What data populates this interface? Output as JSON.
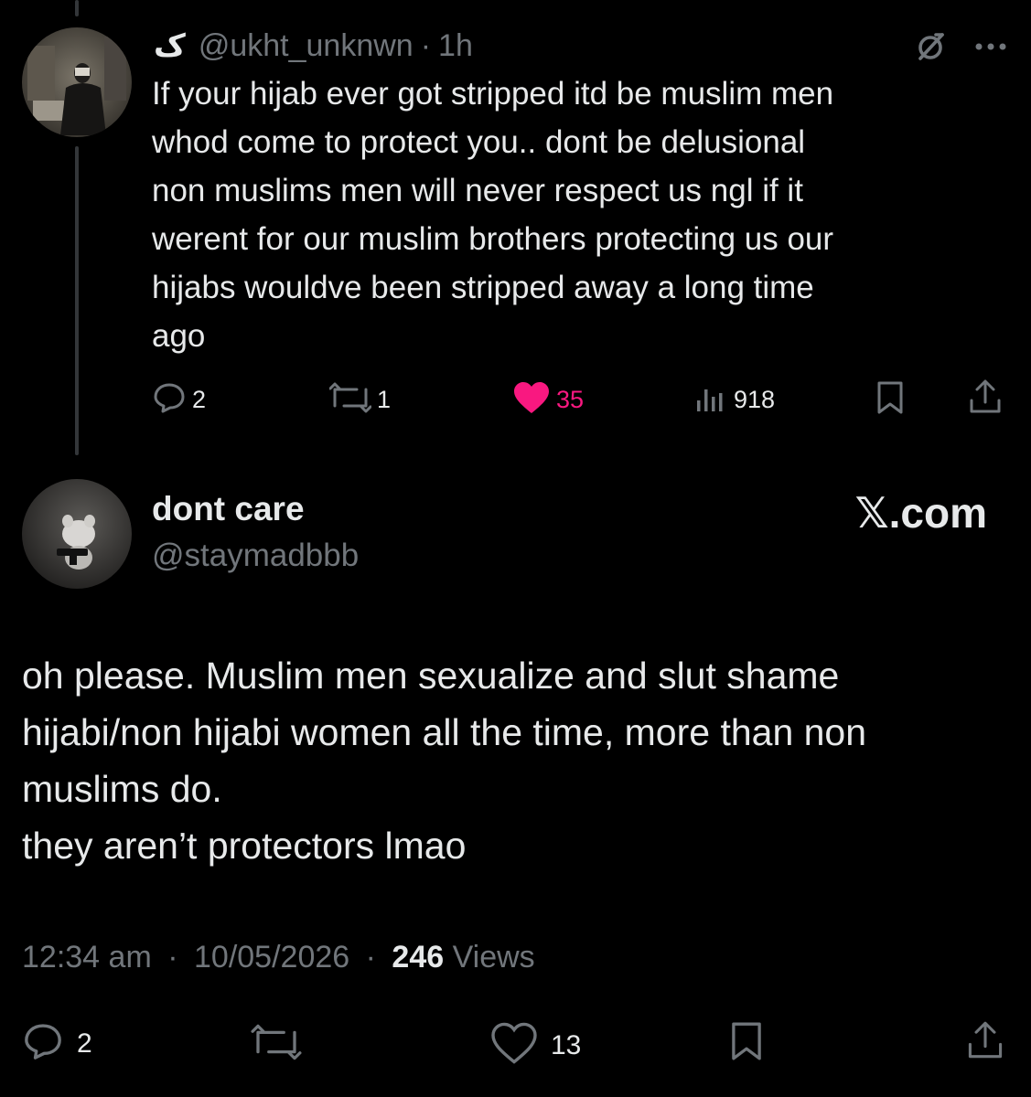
{
  "parent_tweet": {
    "display_name": "ک",
    "handle": "@ukht_unknwn",
    "time_separator": "·",
    "time": "1h",
    "text": "If your hijab ever got stripped itd be muslim men\nwhod come to protect you.. dont be delusional\nnon muslims men will never respect us ngl if it\nwerent for our muslim brothers protecting us our\nhijabs wouldve been stripped away a long time\nago",
    "replies": "2",
    "reposts": "1",
    "likes": "35",
    "views": "918",
    "icons": [
      "reply-icon",
      "repost-icon",
      "like-icon",
      "views-icon",
      "bookmark-icon",
      "share-icon",
      "grok-icon",
      "more-icon"
    ]
  },
  "reply_tweet": {
    "display_name": "dont care",
    "handle": "@staymadbbb",
    "watermark": "𝕏.com",
    "text": "oh please. Muslim men sexualize and slut shame\nhijabi/non hijabi women all the time, more than non\nmuslims do.\nthey aren’t protectors lmao",
    "time": "12:34 am",
    "separator": "·",
    "date": "10/05/2026",
    "views_count": "246",
    "views_label": "Views",
    "replies": "2",
    "likes": "13",
    "icons": [
      "reply-icon",
      "repost-icon",
      "like-icon",
      "bookmark-icon",
      "share-icon"
    ]
  },
  "colors": {
    "background": "#000000",
    "text": "#e7e9ea",
    "secondary": "#71767b",
    "like_pink": "#f91880",
    "thread_line": "#333639"
  }
}
